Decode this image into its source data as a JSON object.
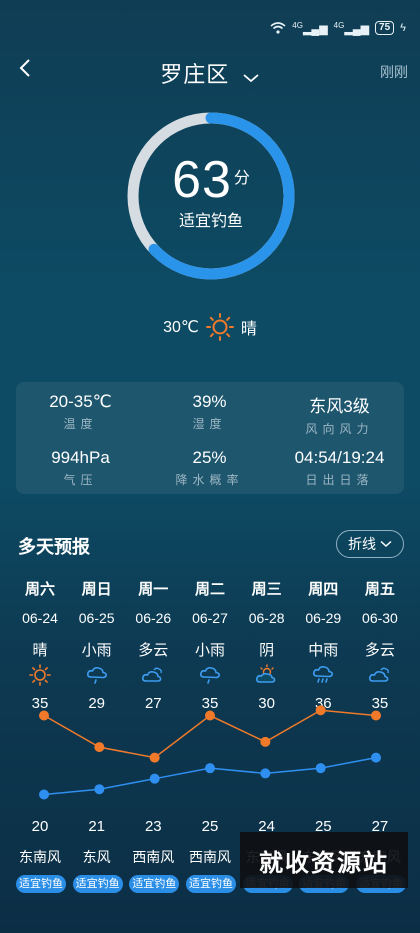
{
  "status_bar": {
    "network_1": "4G",
    "network_2": "4G",
    "battery": "75"
  },
  "header": {
    "title": "罗庄区",
    "updated": "刚刚"
  },
  "fishing_index": {
    "score": "63",
    "unit": "分",
    "label": "适宜钓鱼",
    "progress": 0.63
  },
  "current": {
    "temp": "30℃",
    "condition": "晴"
  },
  "details": [
    {
      "value": "20-35℃",
      "label": "温度"
    },
    {
      "value": "39%",
      "label": "湿度"
    },
    {
      "value": "东风3级",
      "label": "风向风力"
    },
    {
      "value": "994hPa",
      "label": "气压"
    },
    {
      "value": "25%",
      "label": "降水概率"
    },
    {
      "value": "04:54/19:24",
      "label": "日出日落"
    }
  ],
  "forecast": {
    "title": "多天预报",
    "toggle_label": "折线",
    "days": [
      {
        "week": "周六",
        "date": "06-24",
        "cond": "晴",
        "icon": "sun-icon",
        "high": "35",
        "low": "20",
        "wind": "东南风",
        "badge": "适宜钓鱼"
      },
      {
        "week": "周日",
        "date": "06-25",
        "cond": "小雨",
        "icon": "light-rain-icon",
        "high": "29",
        "low": "21",
        "wind": "东风",
        "badge": "适宜钓鱼"
      },
      {
        "week": "周一",
        "date": "06-26",
        "cond": "多云",
        "icon": "cloudy-icon",
        "high": "27",
        "low": "23",
        "wind": "西南风",
        "badge": "适宜钓鱼"
      },
      {
        "week": "周二",
        "date": "06-27",
        "cond": "小雨",
        "icon": "light-rain-icon",
        "high": "35",
        "low": "25",
        "wind": "西南风",
        "badge": "适宜钓鱼"
      },
      {
        "week": "周三",
        "date": "06-28",
        "cond": "阴",
        "icon": "overcast-icon",
        "high": "30",
        "low": "24",
        "wind": "东南风",
        "badge": "适宜钓鱼"
      },
      {
        "week": "周四",
        "date": "06-29",
        "cond": "中雨",
        "icon": "moderate-rain-icon",
        "high": "36",
        "low": "25",
        "wind": "东南风",
        "badge": "适宜钓鱼"
      },
      {
        "week": "周五",
        "date": "06-30",
        "cond": "多云",
        "icon": "cloudy-icon",
        "high": "35",
        "low": "27",
        "wind": "东南风",
        "badge": "适宜钓鱼"
      }
    ]
  },
  "chart_data": {
    "type": "line",
    "categories": [
      "06-24",
      "06-25",
      "06-26",
      "06-27",
      "06-28",
      "06-29",
      "06-30"
    ],
    "series": [
      {
        "values": [
          35,
          29,
          27,
          35,
          30,
          36,
          35
        ],
        "color": "#f07a2a"
      },
      {
        "values": [
          20,
          21,
          23,
          25,
          24,
          25,
          27
        ],
        "color": "#2f8ff0"
      }
    ]
  },
  "watermark": "就收资源站",
  "colors": {
    "accent": "#2a8ee6",
    "high_line": "#f07a2a",
    "low_line": "#2f8ff0",
    "sun": "#f07a2a"
  }
}
